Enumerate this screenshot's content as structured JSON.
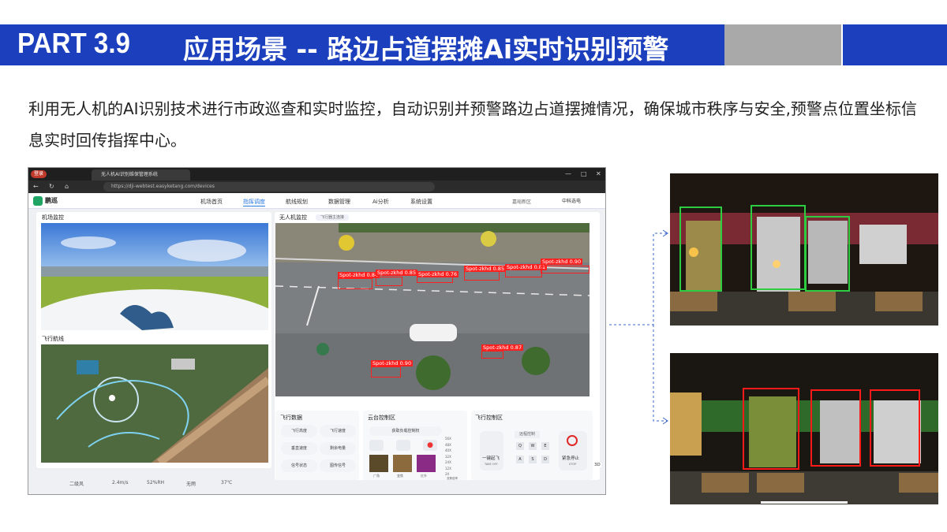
{
  "header": {
    "part_label": "PART 3.9",
    "title": "应用场景 -- 路边占道摆摊Ai实时识别预警"
  },
  "description": "利用无人机的AI识别技术进行市政巡查和实时监控，自动识别并预警路边占道摆摊情况，确保城市秩序与安全,预警点位置坐标信息实时回传指挥中心。",
  "browser": {
    "login_badge": "登录",
    "tab_title": "无人机AI识别维保管理系统",
    "url": "https://dji-webtest.easyketang.com/devices"
  },
  "app": {
    "logo": "鹏巡",
    "nav": [
      "机场首页",
      "指挥调度",
      "航线规划",
      "数据管理",
      "Ai分析",
      "系统设置"
    ],
    "active_nav": "指挥调度",
    "zone": "嘉峪新区",
    "user": "中科选电"
  },
  "panels": {
    "airport_monitor": "机场监控",
    "flight_route": "飞行航线",
    "drone_monitor": "无人机监控",
    "drone_tab": "飞行器主连接",
    "flight_data": "飞行数据",
    "gimbal_control": "云台控制区",
    "flight_control": "飞行控制区"
  },
  "detections": [
    {
      "label": "Spot-zkhd 0.84"
    },
    {
      "label": "Spot-zkhd 0.85"
    },
    {
      "label": "Spot-zkhd 0.76"
    },
    {
      "label": "Spot-zkhd 0.85"
    },
    {
      "label": "Spot-zkhd 0.81"
    },
    {
      "label": "Spot-zkhd 0.90"
    },
    {
      "label": "Spot-zkhd 0.87"
    },
    {
      "label": "Spot-zkhd 0.90"
    }
  ],
  "flight_data_items": [
    "飞行高度",
    "飞行速度",
    "垂直速度",
    "剩余电量",
    "信号状态",
    "图传信号"
  ],
  "gimbal": {
    "button": "获取负载控制权",
    "modes": [
      "广角",
      "变焦",
      "红外"
    ],
    "zoom_levels": [
      "56X",
      "48X",
      "40X",
      "32X",
      "24X",
      "12X",
      "2X"
    ],
    "zoom_caption": "变焦倍率"
  },
  "flight_control": {
    "takeoff": "一键起飞",
    "takeoff_sub": "TAKE OFF",
    "remote": "远程控制",
    "keys": [
      "Q",
      "W",
      "E",
      "A",
      "S",
      "D"
    ],
    "stop": "紧急停止",
    "stop_sub": "STOP",
    "mode_3d": "3D"
  },
  "weather": [
    "二级风",
    "2.4m/s",
    "52%RH",
    "无雨",
    "37℃"
  ],
  "colors": {
    "header_blue": "#1c3fbe",
    "header_gray": "#a9a9a9",
    "detect_red": "#ff2020",
    "detect_green": "#2ecc40",
    "accent": "#2a7ae2"
  }
}
